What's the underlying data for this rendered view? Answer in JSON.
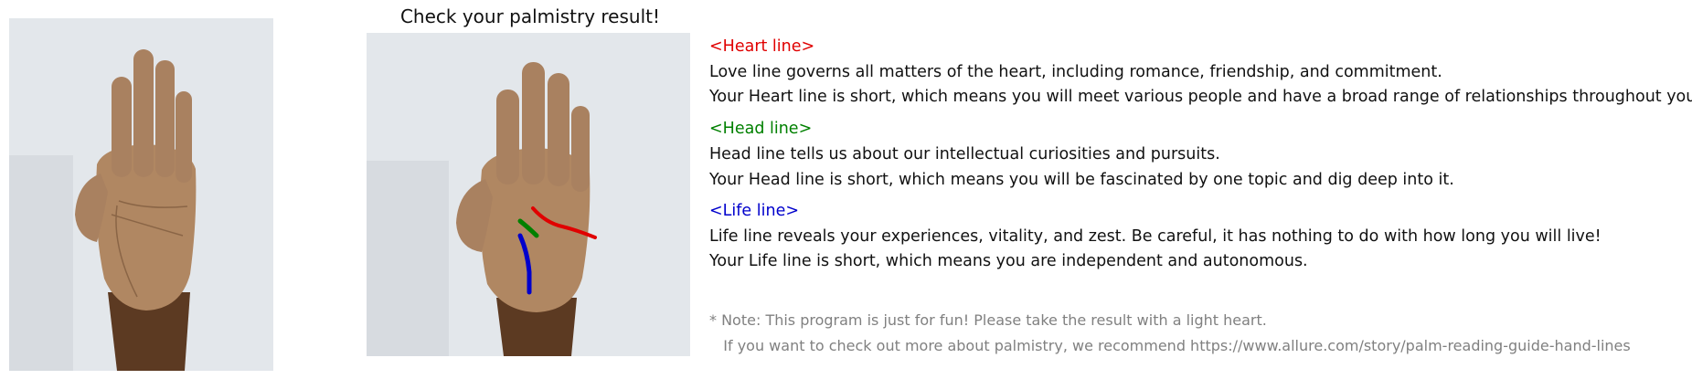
{
  "title": "Check your palmistry result!",
  "colors": {
    "heart": "#e00000",
    "head": "#008000",
    "life": "#0000cc",
    "note": "#808080"
  },
  "images": {
    "original_hand": "palm-photo",
    "annotated_hand": "palm-photo-with-lines"
  },
  "heart": {
    "header": "<Heart line>",
    "desc": "Love line governs all matters of the heart, including romance, friendship, and commitment.",
    "result": "Your Heart line is short, which means you will meet various people and have a broad range of relationships throughout your life."
  },
  "head": {
    "header": "<Head line>",
    "desc": "Head line tells us about our intellectual curiosities and pursuits.",
    "result": "Your Head line is short, which means you will be fascinated by one topic and dig deep into it."
  },
  "life": {
    "header": "<Life line>",
    "desc": "Life line reveals your experiences, vitality, and zest. Be careful, it has nothing to do with how long you will live!",
    "result": "Your Life line is short, which means you are independent and autonomous."
  },
  "note": {
    "line1": "* Note: This program is just for fun! Please take the result with a light heart.",
    "line2": "   If you want to check out more about palmistry, we recommend https://www.allure.com/story/palm-reading-guide-hand-lines"
  }
}
